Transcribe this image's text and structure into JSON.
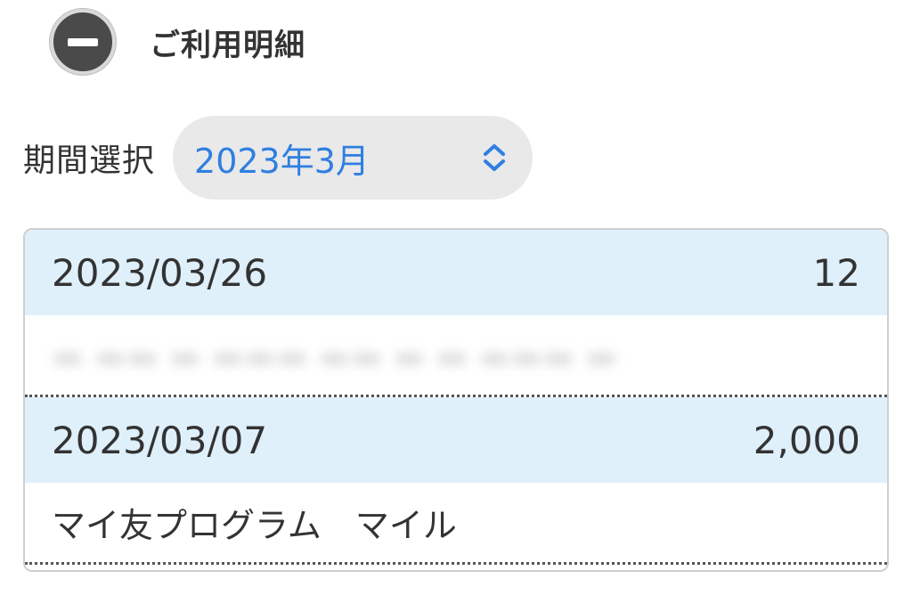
{
  "header": {
    "title": "ご利用明細",
    "toggle_icon": "minus-circle-icon"
  },
  "period": {
    "label": "期間選択",
    "selected": "2023年3月",
    "accent_color": "#2f7fe0"
  },
  "entries": [
    {
      "date": "2023/03/26",
      "amount": "12",
      "description": "",
      "description_obscured": true
    },
    {
      "date": "2023/03/07",
      "amount": "2,000",
      "description": "マイ友プログラム　マイル",
      "description_obscured": false
    }
  ],
  "colors": {
    "row_header_bg": "#dff0fb",
    "select_bg": "#e9e9e9"
  }
}
